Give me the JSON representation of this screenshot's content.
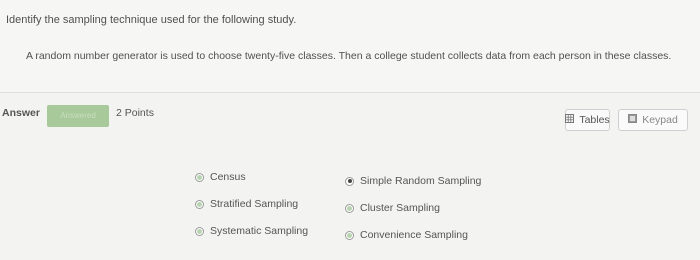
{
  "question": {
    "prompt": "Identify the sampling technique used for the following study.",
    "detail": "A random number generator is used to choose twenty-five classes. Then a college student collects data from each person in these classes."
  },
  "answer_bar": {
    "answer_label": "Answer",
    "answered_badge": "Answered",
    "points": "2 Points",
    "tables_label": "Tables",
    "keypad_label": "Keypad"
  },
  "options": [
    {
      "label": "Census",
      "selected": false
    },
    {
      "label": "Stratified Sampling",
      "selected": false
    },
    {
      "label": "Systematic Sampling",
      "selected": false
    },
    {
      "label": "Simple Random Sampling",
      "selected": true
    },
    {
      "label": "Cluster Sampling",
      "selected": false
    },
    {
      "label": "Convenience Sampling",
      "selected": false
    }
  ],
  "colors": {
    "answered_badge": "#a8c99a",
    "radio_fill": "#b7d4b0"
  },
  "icons": {
    "tables": "table-grid-icon",
    "keypad": "keypad-icon"
  }
}
